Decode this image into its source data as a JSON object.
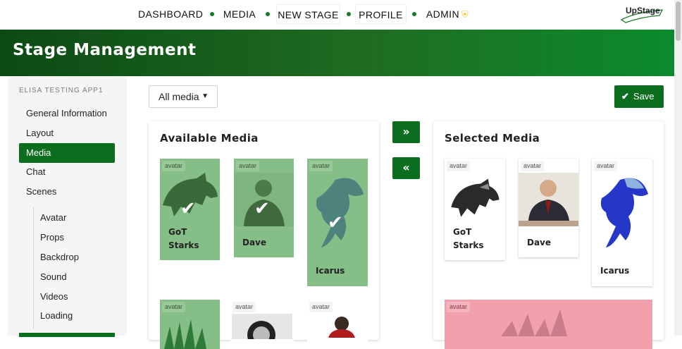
{
  "nav": {
    "items": [
      {
        "label": "DASHBOARD"
      },
      {
        "label": "MEDIA"
      },
      {
        "label": "NEW STAGE"
      },
      {
        "label": "PROFILE"
      },
      {
        "label": "ADMIN"
      }
    ],
    "logo": "UpStage"
  },
  "banner": {
    "title": "Stage Management"
  },
  "sidebar": {
    "stage_name": "ELISA TESTING APP1",
    "items": [
      {
        "label": "General Information"
      },
      {
        "label": "Layout"
      },
      {
        "label": "Media"
      },
      {
        "label": "Chat"
      },
      {
        "label": "Scenes"
      }
    ],
    "subitems": [
      {
        "label": "Avatar"
      },
      {
        "label": "Props"
      },
      {
        "label": "Backdrop"
      },
      {
        "label": "Sound"
      },
      {
        "label": "Videos"
      },
      {
        "label": "Loading"
      }
    ],
    "active": "Media"
  },
  "toolbar": {
    "filter_value": "All media",
    "save_label": "Save"
  },
  "available": {
    "title": "Available Media",
    "cards": [
      {
        "tag": "avatar",
        "label": "GoT Starks",
        "selected": true
      },
      {
        "tag": "avatar",
        "label": "Dave",
        "selected": true
      },
      {
        "tag": "avatar",
        "label": "Icarus",
        "selected": true
      },
      {
        "tag": "avatar",
        "label": "",
        "selected": true
      },
      {
        "tag": "avatar",
        "label": "",
        "selected": false
      },
      {
        "tag": "avatar",
        "label": "",
        "selected": false
      }
    ]
  },
  "transfer": {
    "add_icon": "double-chevron-right-icon",
    "remove_icon": "double-chevron-left-icon"
  },
  "selected": {
    "title": "Selected Media",
    "cards": [
      {
        "tag": "avatar",
        "label": "GoT Starks"
      },
      {
        "tag": "avatar",
        "label": "Dave"
      },
      {
        "tag": "avatar",
        "label": "Icarus"
      },
      {
        "tag": "avatar",
        "label": ""
      }
    ]
  },
  "colors": {
    "accent": "#0b6e1e",
    "picked": "#86be88",
    "banner_start": "#0c4a14",
    "banner_end": "#0b8a2c"
  }
}
